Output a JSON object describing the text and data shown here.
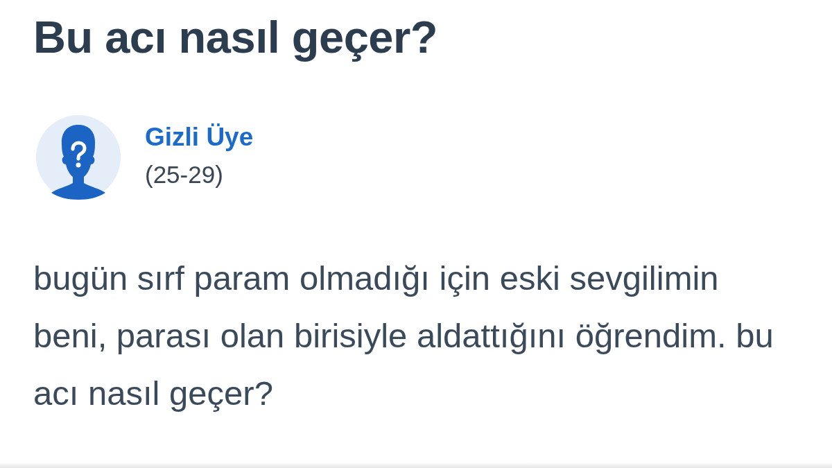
{
  "question": {
    "title": "Bu acı nasıl geçer?"
  },
  "author": {
    "name": "Gizli Üye",
    "age_range": "(25-29)"
  },
  "body": {
    "text": "bugün sırf param olmadığı için eski sevgilimin beni, parası olan birisiyle aldattığını öğrendim. bu acı nasıl geçer?"
  }
}
